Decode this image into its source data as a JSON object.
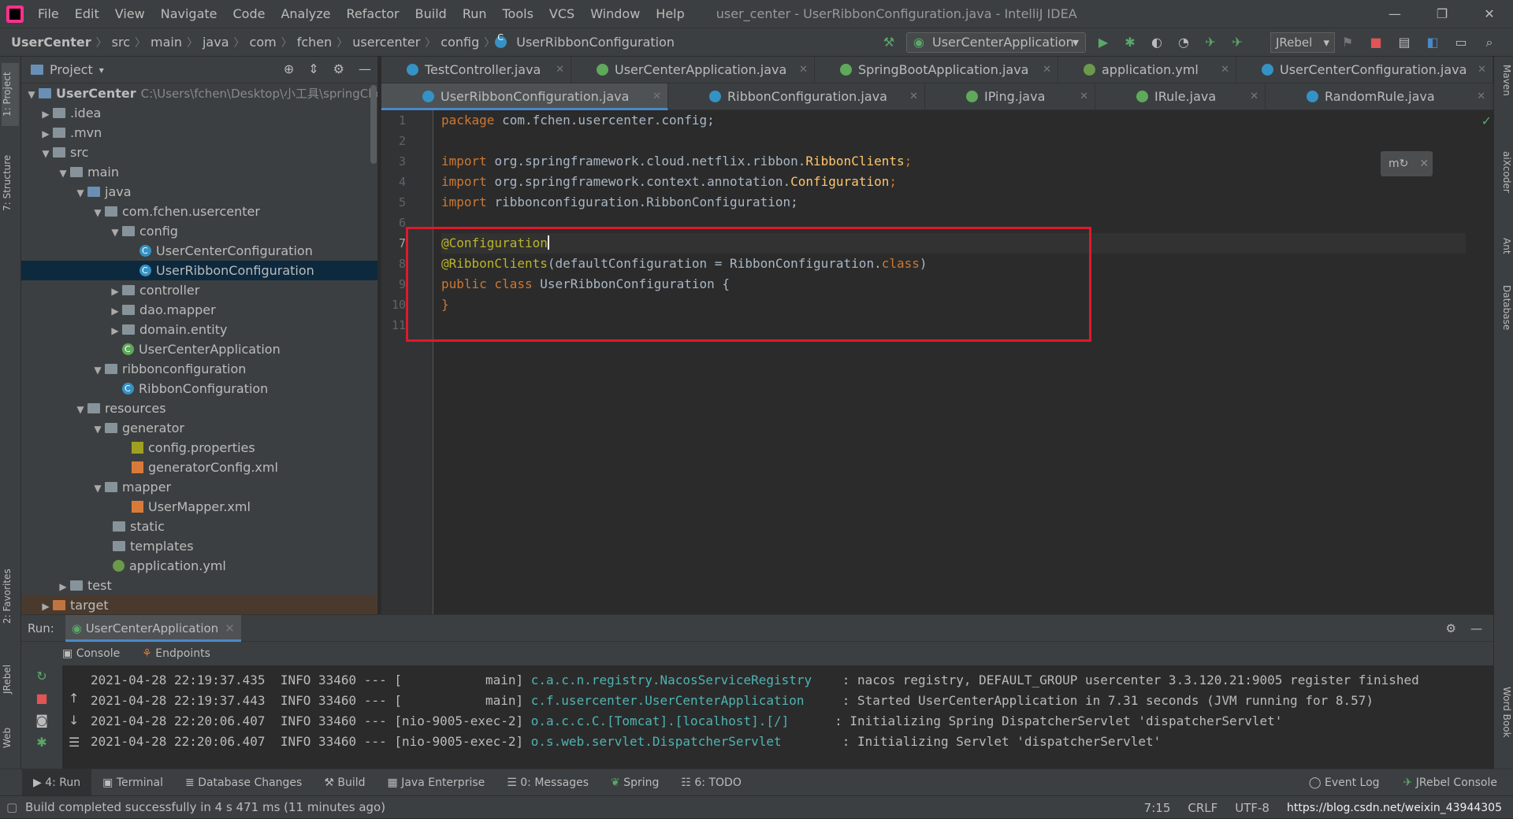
{
  "menubar": {
    "items": [
      "File",
      "Edit",
      "View",
      "Navigate",
      "Code",
      "Analyze",
      "Refactor",
      "Build",
      "Run",
      "Tools",
      "VCS",
      "Window",
      "Help"
    ],
    "title": "user_center - UserRibbonConfiguration.java - IntelliJ IDEA"
  },
  "breadcrumbs": [
    "UserCenter",
    "src",
    "main",
    "java",
    "com",
    "fchen",
    "usercenter",
    "config",
    "UserRibbonConfiguration"
  ],
  "toolbar": {
    "run_config": "UserCenterApplication",
    "jrebel": "JRebel"
  },
  "left_strip": {
    "project": "1: Project",
    "structure": "7: Structure",
    "favorites": "2: Favorites",
    "jrebel": "JRebel",
    "web": "Web"
  },
  "right_strip": {
    "maven": "Maven",
    "aixcoder": "aiXcoder",
    "ant": "Ant",
    "database": "Database",
    "wordbook": "Word Book"
  },
  "project": {
    "title": "Project",
    "root": "UserCenter",
    "root_path": "C:\\Users\\fchen\\Desktop\\小工具\\springClou",
    "tree": [
      {
        "label": ".idea"
      },
      {
        "label": ".mvn"
      },
      {
        "label": "src"
      },
      {
        "label": "main"
      },
      {
        "label": "java"
      },
      {
        "label": "com.fchen.usercenter"
      },
      {
        "label": "config"
      },
      {
        "label": "UserCenterConfiguration"
      },
      {
        "label": "UserRibbonConfiguration"
      },
      {
        "label": "controller"
      },
      {
        "label": "dao.mapper"
      },
      {
        "label": "domain.entity"
      },
      {
        "label": "UserCenterApplication"
      },
      {
        "label": "ribbonconfiguration"
      },
      {
        "label": "RibbonConfiguration"
      },
      {
        "label": "resources"
      },
      {
        "label": "generator"
      },
      {
        "label": "config.properties"
      },
      {
        "label": "generatorConfig.xml"
      },
      {
        "label": "mapper"
      },
      {
        "label": "UserMapper.xml"
      },
      {
        "label": "static"
      },
      {
        "label": "templates"
      },
      {
        "label": "application.yml"
      },
      {
        "label": "test"
      },
      {
        "label": "target"
      }
    ]
  },
  "editor": {
    "tabs_row1": [
      "TestController.java",
      "UserCenterApplication.java",
      "SpringBootApplication.java",
      "application.yml",
      "UserCenterConfiguration.java"
    ],
    "tabs_row2": [
      "UserRibbonConfiguration.java",
      "RibbonConfiguration.java",
      "IPing.java",
      "IRule.java",
      "RandomRule.java"
    ],
    "line_numbers": [
      "1",
      "2",
      "3",
      "4",
      "5",
      "6",
      "7",
      "8",
      "9",
      "10",
      "11"
    ],
    "code": {
      "l1_kw": "package ",
      "l1_pkg": "com.fchen.usercenter.config;",
      "l3_kw": "import ",
      "l3_pkg": "org.springframework.cloud.netflix.ribbon.",
      "l3_cls": "RibbonClients",
      "l4_kw": "import ",
      "l4_pkg": "org.springframework.context.annotation.",
      "l4_cls": "Configuration",
      "l5_kw": "import ",
      "l5_pkg": "ribbonconfiguration.RibbonConfiguration;",
      "l7_an": "@Configuration",
      "l8_an": "@RibbonClients",
      "l8_rest": "(defaultConfiguration = RibbonConfiguration.",
      "l8_kw": "class",
      "l8_end": ")",
      "l9_kw": "public class ",
      "l9_rest": "UserRibbonConfiguration {",
      "l10": "}"
    }
  },
  "run": {
    "label": "Run:",
    "config": "UserCenterApplication",
    "subtabs": [
      "Console",
      "Endpoints"
    ],
    "logs": [
      {
        "ts": "2021-04-28 22:19:37.435",
        "lvl": "INFO",
        "pid": "33460",
        "sep": "---",
        "thread": "[           main]",
        "logger": "c.a.c.n.registry.NacosServiceRegistry   ",
        "msg": ": nacos registry, DEFAULT_GROUP usercenter 3.3.120.21:9005 register finished"
      },
      {
        "ts": "2021-04-28 22:19:37.443",
        "lvl": "INFO",
        "pid": "33460",
        "sep": "---",
        "thread": "[           main]",
        "logger": "c.f.usercenter.UserCenterApplication    ",
        "msg": ": Started UserCenterApplication in 7.31 seconds (JVM running for 8.57)"
      },
      {
        "ts": "2021-04-28 22:20:06.407",
        "lvl": "INFO",
        "pid": "33460",
        "sep": "---",
        "thread": "[nio-9005-exec-2]",
        "logger": "o.a.c.c.C.[Tomcat].[localhost].[/]     ",
        "msg": ": Initializing Spring DispatcherServlet 'dispatcherServlet'"
      },
      {
        "ts": "2021-04-28 22:20:06.407",
        "lvl": "INFO",
        "pid": "33460",
        "sep": "---",
        "thread": "[nio-9005-exec-2]",
        "logger": "o.s.web.servlet.DispatcherServlet       ",
        "msg": ": Initializing Servlet 'dispatcherServlet'"
      }
    ]
  },
  "bottom_tabs": [
    "4: Run",
    "Terminal",
    "Database Changes",
    "Build",
    "Java Enterprise",
    "0: Messages",
    "Spring",
    "6: TODO"
  ],
  "bottom_right": [
    "Event Log",
    "JRebel Console"
  ],
  "status": {
    "message": "Build completed successfully in 4 s 471 ms (11 minutes ago)",
    "position": "7:15",
    "line_sep": "CRLF",
    "encoding": "UTF-8",
    "watermark": "https://blog.csdn.net/weixin_43944305"
  }
}
